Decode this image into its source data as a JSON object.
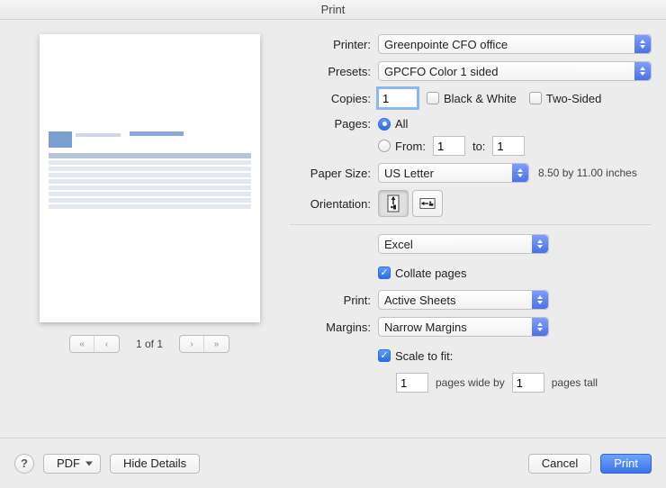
{
  "title": "Print",
  "labels": {
    "printer": "Printer:",
    "presets": "Presets:",
    "copies": "Copies:",
    "pages": "Pages:",
    "paperSize": "Paper Size:",
    "orientation": "Orientation:",
    "print": "Print:",
    "margins": "Margins:"
  },
  "printer": {
    "value": "Greenpointe CFO office"
  },
  "presets": {
    "value": "GPCFO Color 1 sided"
  },
  "copies": {
    "value": "1"
  },
  "bw": {
    "label": "Black & White"
  },
  "twosided": {
    "label": "Two-Sided"
  },
  "pagesGroup": {
    "all": "All",
    "fromLabel": "From:",
    "fromValue": "1",
    "toLabel": "to:",
    "toValue": "1"
  },
  "paperSize": {
    "value": "US Letter",
    "dims": "8.50 by 11.00 inches"
  },
  "app": {
    "value": "Excel"
  },
  "collate": {
    "label": "Collate pages"
  },
  "printWhat": {
    "value": "Active Sheets"
  },
  "margins": {
    "value": "Narrow Margins"
  },
  "scale": {
    "label": "Scale to fit:",
    "wideVal": "1",
    "wideLabel": "pages wide by",
    "tallVal": "1",
    "tallLabel": "pages tall"
  },
  "pager": {
    "label": "1 of 1"
  },
  "footer": {
    "pdf": "PDF",
    "hideDetails": "Hide Details",
    "cancel": "Cancel",
    "print": "Print"
  }
}
